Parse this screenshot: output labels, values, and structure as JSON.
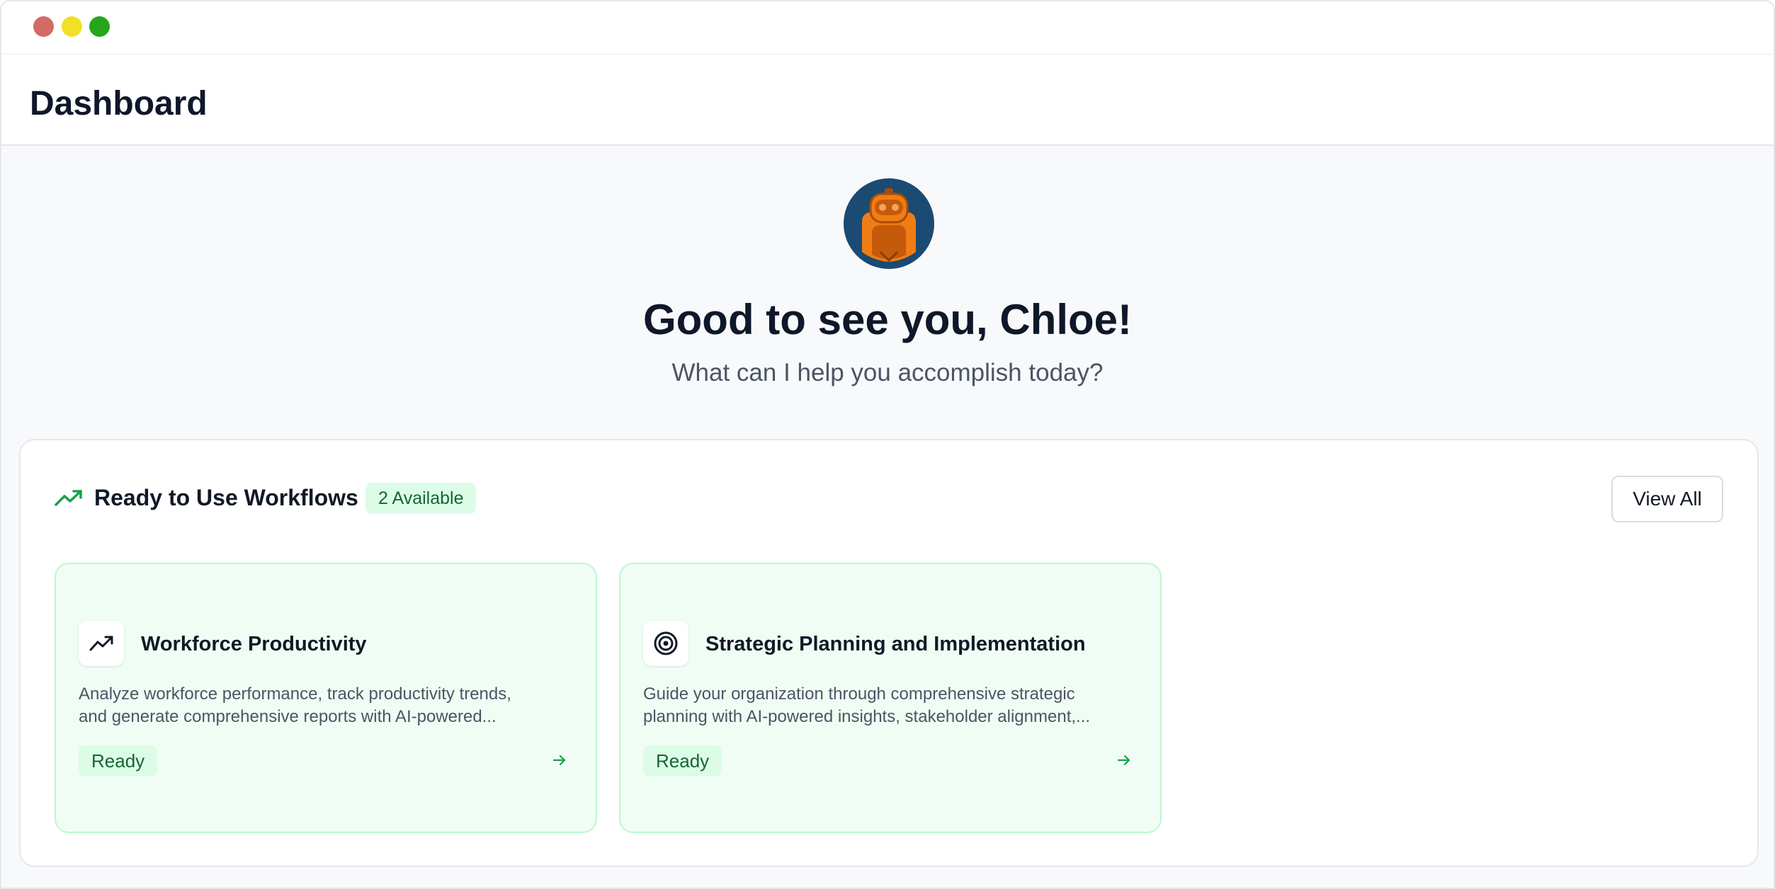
{
  "header": {
    "title": "Dashboard"
  },
  "hero": {
    "avatar_icon": "robot-avatar",
    "greeting": "Good to see you, Chloe!",
    "subtitle": "What can I help you accomplish today?"
  },
  "workflows": {
    "icon": "trending-up-icon",
    "title": "Ready to Use Workflows",
    "available_badge": "2 Available",
    "view_all_label": "View All",
    "cards": [
      {
        "icon": "trending-up-icon",
        "title": "Workforce Productivity",
        "description_line1": "Analyze workforce performance, track productivity trends,",
        "description_line2": "and generate comprehensive reports with AI-powered...",
        "status": "Ready",
        "arrow_icon": "arrow-right-icon"
      },
      {
        "icon": "target-icon",
        "title": "Strategic Planning and Implementation",
        "description_line1": "Guide your organization through comprehensive strategic",
        "description_line2": "planning with AI-powered insights, stakeholder alignment,...",
        "status": "Ready",
        "arrow_icon": "arrow-right-icon"
      }
    ]
  },
  "colors": {
    "accent_green": "#16a34a",
    "badge_bg": "#dcfce7",
    "badge_text": "#166534",
    "card_bg": "#f0fdf4",
    "card_border": "#bbf7d0",
    "avatar_bg": "#1b4a72",
    "avatar_orange": "#f07c14"
  }
}
